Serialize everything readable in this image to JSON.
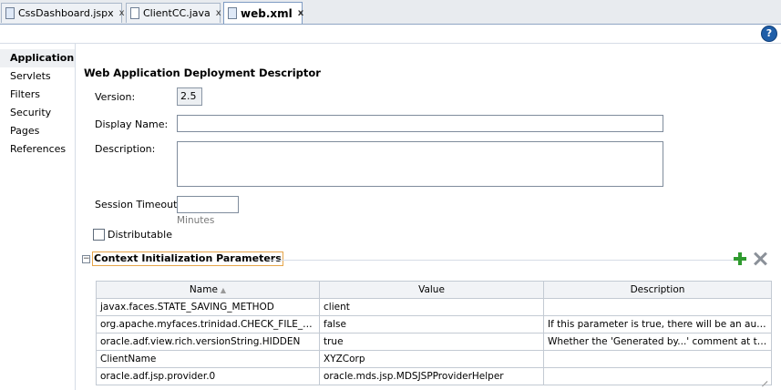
{
  "tabs": [
    {
      "label": "CssDashboard.jspx",
      "close": "x",
      "icon": "jspx-file-icon"
    },
    {
      "label": "ClientCC.java",
      "close": "x",
      "icon": "java-file-icon"
    },
    {
      "label": "web.xml",
      "close": "x",
      "icon": "xml-file-icon",
      "active": true
    }
  ],
  "help": {
    "glyph": "?"
  },
  "sidebar": {
    "items": [
      {
        "label": "Application",
        "selected": true
      },
      {
        "label": "Servlets"
      },
      {
        "label": "Filters"
      },
      {
        "label": "Security"
      },
      {
        "label": "Pages"
      },
      {
        "label": "References"
      }
    ]
  },
  "main": {
    "heading": "Web Application Deployment Descriptor",
    "version_label": "Version:",
    "version_value": "2.5",
    "display_name_label": "Display Name:",
    "display_name_value": "",
    "description_label": "Description:",
    "description_value": "",
    "session_timeout_label": "Session Timeout:",
    "session_timeout_value": "",
    "session_timeout_hint": "Minutes",
    "distributable_label": "Distributable",
    "distributable_checked": false
  },
  "params": {
    "title": "Context Initialization Parameters",
    "toggle": "−",
    "columns": [
      "Name",
      "Value",
      "Description"
    ],
    "rows": [
      [
        "javax.faces.STATE_SAVING_METHOD",
        "client",
        ""
      ],
      [
        "org.apache.myfaces.trinidad.CHECK_FILE_M...",
        "false",
        "If this parameter is true, there will be an auto..."
      ],
      [
        "oracle.adf.view.rich.versionString.HIDDEN",
        "true",
        "Whether the 'Generated by...' comment at th..."
      ],
      [
        "ClientName",
        "XYZCorp",
        ""
      ],
      [
        "oracle.adf.jsp.provider.0",
        "oracle.mds.jsp.MDSJSPProviderHelper",
        ""
      ]
    ]
  },
  "colors": {
    "accent": "#1f5ea8",
    "add_green": "#2f9a2f",
    "section_highlight": "#e6a54a"
  }
}
